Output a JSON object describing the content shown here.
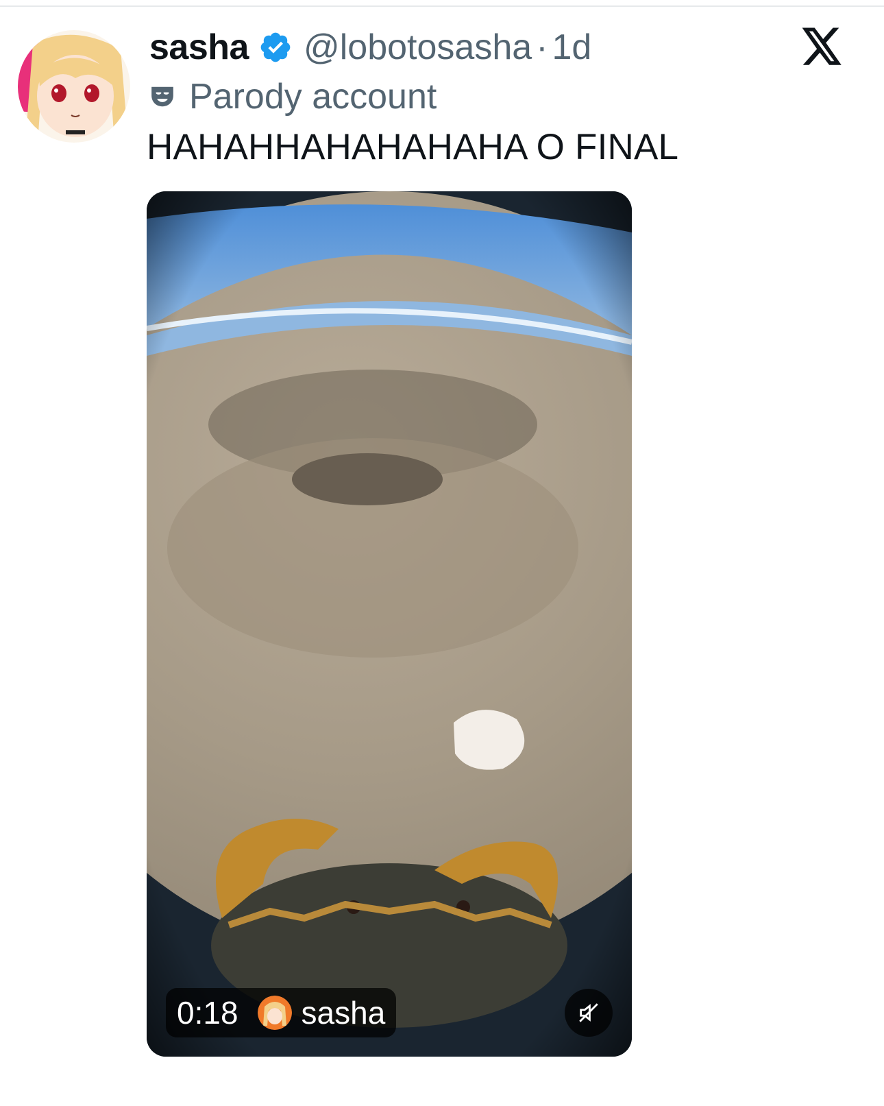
{
  "tweet": {
    "display_name": "sasha",
    "handle": "@lobotosasha",
    "separator": "·",
    "time": "1d",
    "parody_label": "Parody account",
    "text": "HAHAHHAHAHAHAHA O FINAL"
  },
  "video": {
    "duration": "0:18",
    "author_name": "sasha"
  },
  "colors": {
    "verified_blue": "#1d9bf0",
    "secondary_text": "#536471",
    "primary_text": "#0f1419"
  },
  "icons": {
    "close": "x-logo-icon",
    "verified": "verified-badge-icon",
    "parody": "theater-mask-icon",
    "mute": "speaker-muted-icon"
  }
}
